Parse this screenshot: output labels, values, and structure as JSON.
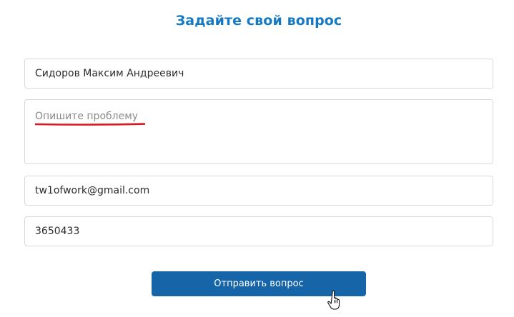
{
  "form": {
    "title": "Задайте свой вопрос",
    "name": {
      "value": "Сидоров Максим Андреевич"
    },
    "problem": {
      "placeholder": "Опишите проблему",
      "value": ""
    },
    "email": {
      "value": "tw1ofwork@gmail.com"
    },
    "phone": {
      "value": "3650433"
    },
    "submit_label": "Отправить вопрос"
  },
  "colors": {
    "title": "#1578c4",
    "button": "#1565a8",
    "annotation": "#e0171f",
    "field_border": "#d9d9d9"
  },
  "icons": {
    "cursor": "hand-pointer-icon"
  }
}
